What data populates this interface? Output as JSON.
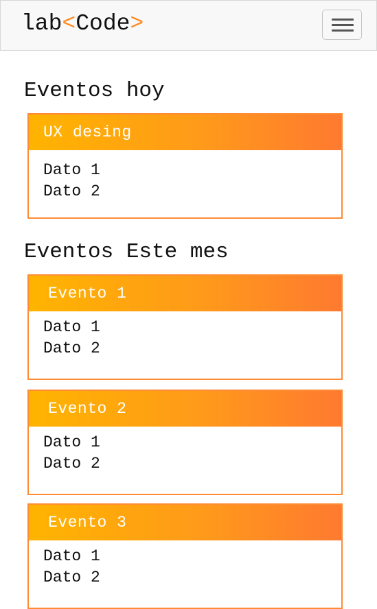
{
  "brand": {
    "prefix": "lab",
    "open_bracket": "<",
    "name": "Code",
    "close_bracket": ">"
  },
  "colors": {
    "accent": "#ff8a1f",
    "header_gradient_start": "#ffb400",
    "header_gradient_end": "#ff7a30",
    "card_border": "#ff8c34"
  },
  "icons": {
    "menu_toggle": "hamburger-icon"
  },
  "sections": [
    {
      "title": "Eventos hoy",
      "cards": [
        {
          "title": "UX desing",
          "items": [
            "Dato 1",
            "Dato 2"
          ]
        }
      ]
    },
    {
      "title": "Eventos Este mes",
      "cards": [
        {
          "title": "Evento 1",
          "items": [
            "Dato 1",
            "Dato 2"
          ]
        },
        {
          "title": "Evento 2",
          "items": [
            "Dato 1",
            "Dato 2"
          ]
        },
        {
          "title": "Evento 3",
          "items": [
            "Dato 1",
            "Dato 2"
          ]
        }
      ]
    }
  ]
}
